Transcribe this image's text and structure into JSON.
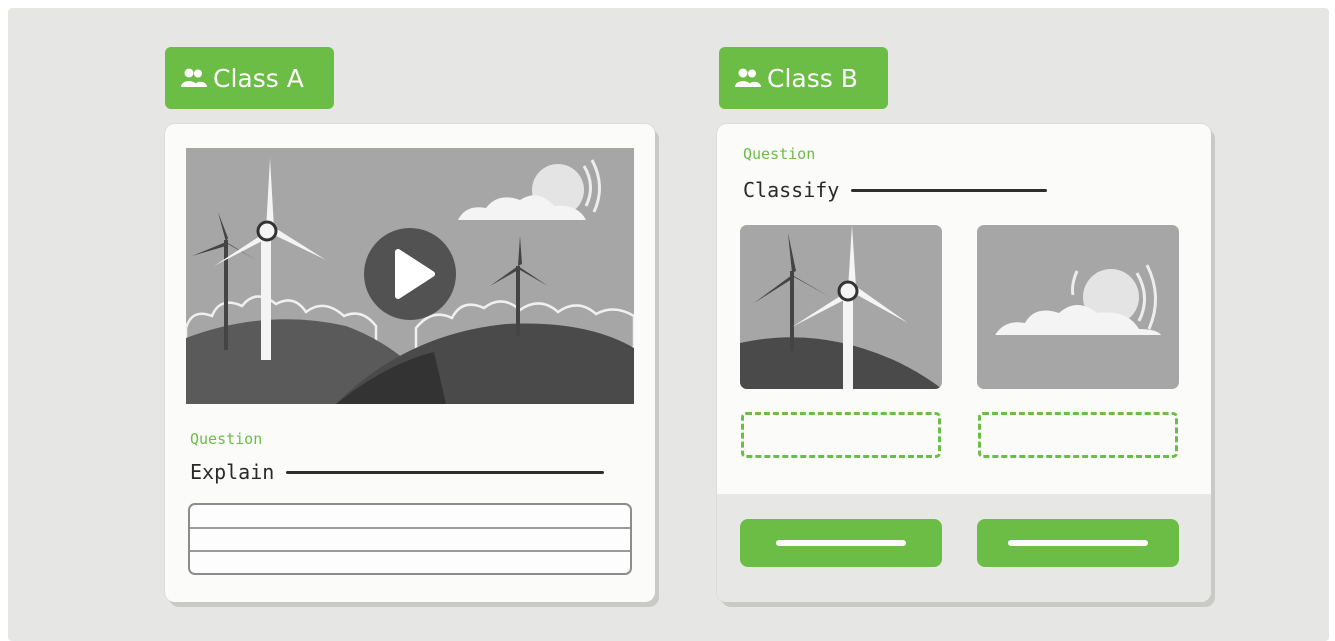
{
  "class_a": {
    "tag_label": "Class A",
    "tag_icon": "people-icon",
    "video": {
      "icon": "play-icon"
    },
    "question_label": "Question",
    "question_text": "Explain"
  },
  "class_b": {
    "tag_label": "Class B",
    "tag_icon": "people-icon",
    "question_label": "Question",
    "question_text": "Classify",
    "options": [
      {
        "image": "wind-turbine-image"
      },
      {
        "image": "cloud-sun-image"
      }
    ]
  },
  "colors": {
    "accent": "#6cbd45",
    "background": "#e6e6e4",
    "card": "#fbfbfa"
  }
}
